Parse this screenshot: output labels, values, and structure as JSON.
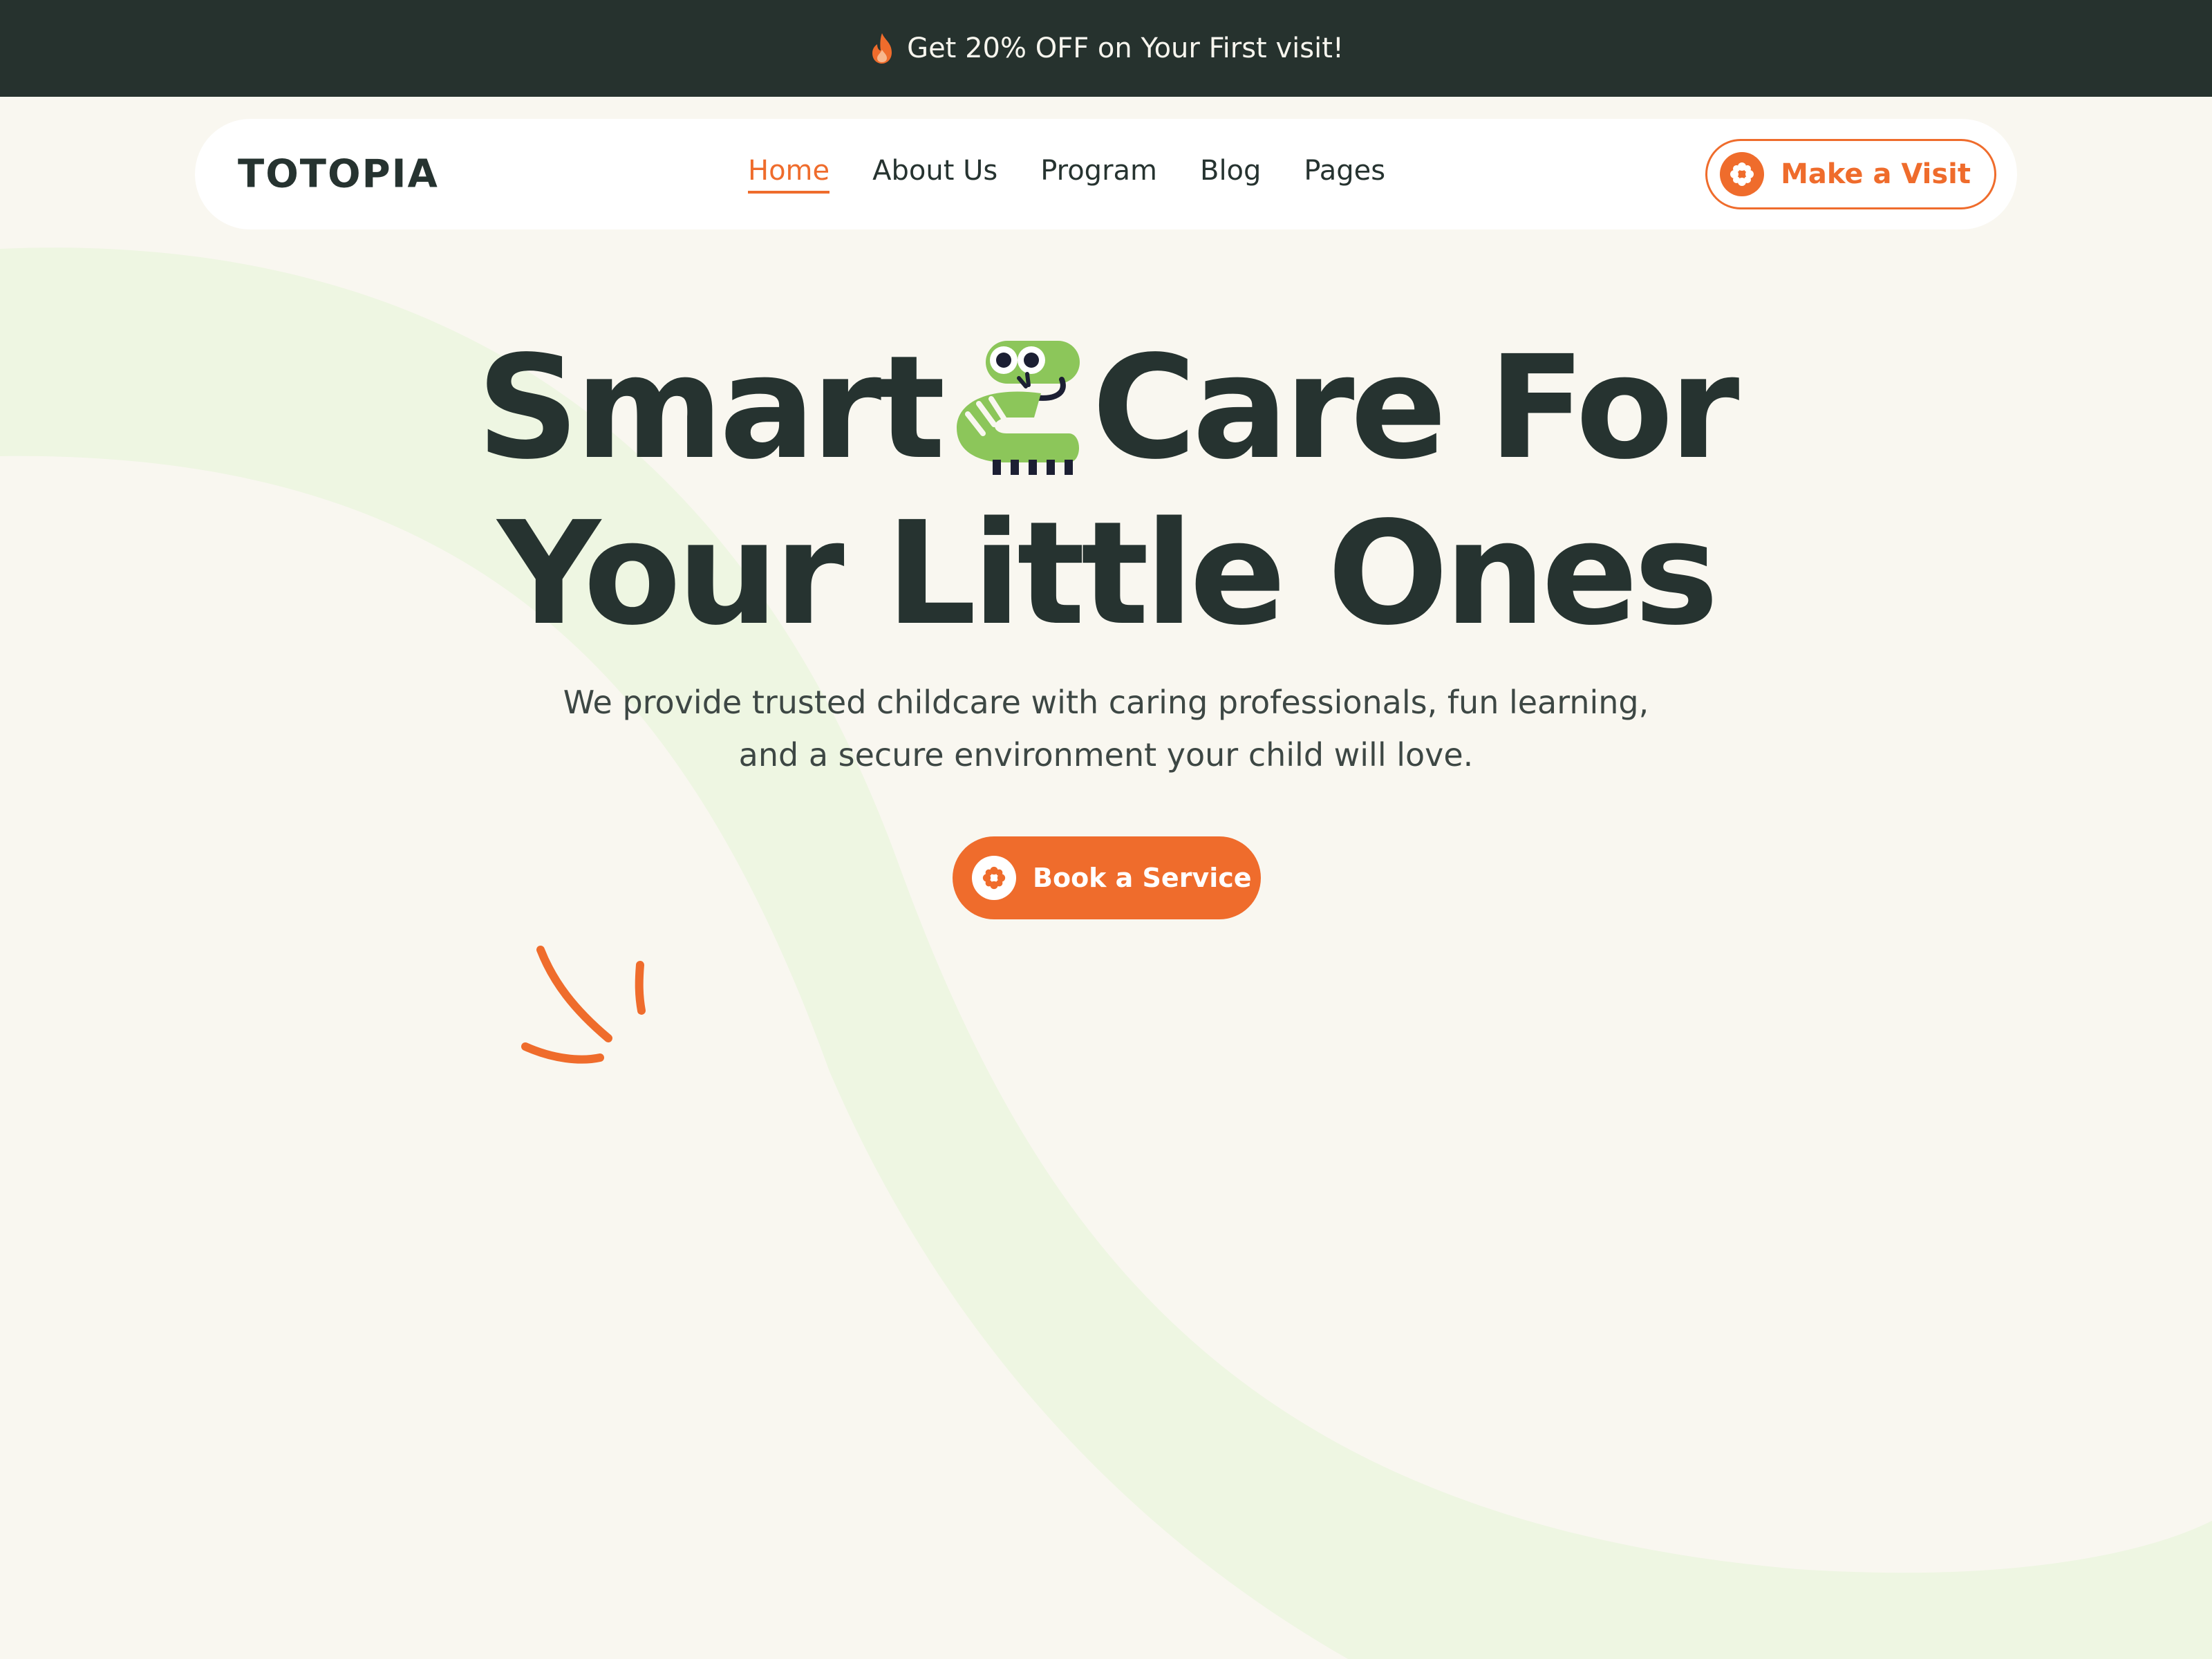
{
  "promo": {
    "text": "Get 20% OFF on Your First visit!",
    "icon": "flame-icon"
  },
  "navbar": {
    "brand": "TOTOPIA",
    "links": [
      {
        "label": "Home",
        "active": true
      },
      {
        "label": "About Us",
        "active": false
      },
      {
        "label": "Program",
        "active": false
      },
      {
        "label": "Blog",
        "active": false
      },
      {
        "label": "Pages",
        "active": false
      }
    ],
    "cta": {
      "label": "Make a Visit",
      "icon": "flower-icon"
    }
  },
  "hero": {
    "title_line1_left": "Smart",
    "title_line1_right": "Care For",
    "title_line2": "Your Little Ones",
    "mascot": "caterpillar-mascot",
    "subtitle": "We provide trusted childcare with caring professionals, fun learning, and a secure environment your child will love.",
    "cta": {
      "label": "Book a Service",
      "icon": "flower-icon"
    }
  },
  "colors": {
    "accent": "#ef6c2c",
    "dark": "#26322e",
    "background": "#f9f7f0",
    "mascot_green": "#8cc65a",
    "swoosh": "#eef6e2"
  }
}
